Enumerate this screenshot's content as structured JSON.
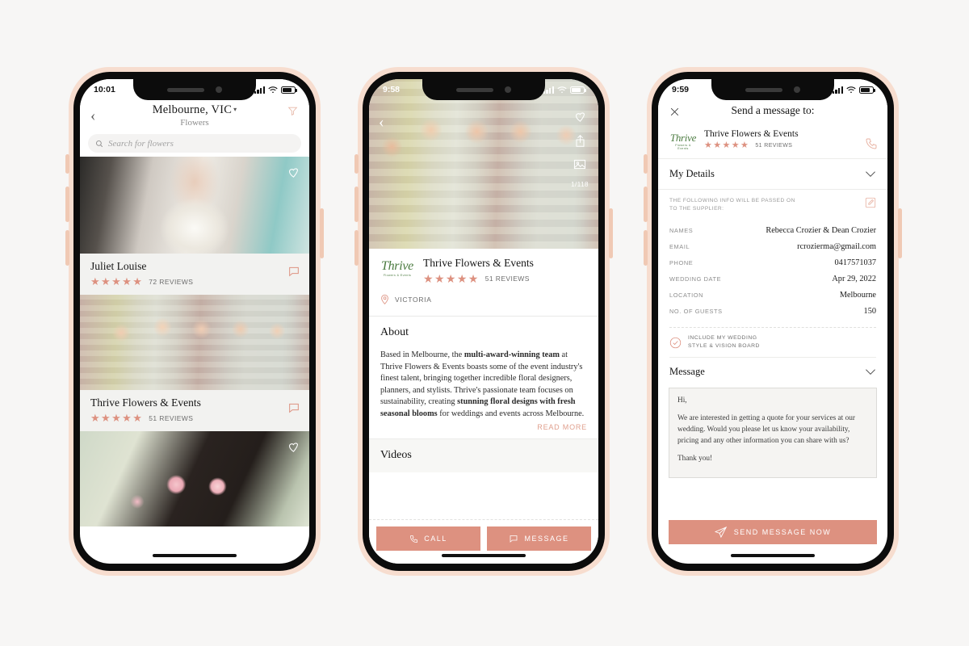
{
  "theme": {
    "accent": "#dd9180",
    "page_background": "#f7f6f5",
    "phone_shell": "#f7ddcf",
    "logo_green": "#4a7a3f"
  },
  "phone1": {
    "status": {
      "time": "10:01"
    },
    "header": {
      "back_icon": "chevron-left-icon",
      "title": "Melbourne, VIC",
      "caret": "▾",
      "subtitle": "Flowers",
      "filter_icon": "filter-funnel-icon"
    },
    "search": {
      "placeholder": "Search for flowers",
      "icon": "search-icon"
    },
    "listings": [
      {
        "name": "Juliet Louise",
        "stars": "★★★★★",
        "reviews": "72 REVIEWS",
        "chat_icon": "chat-bubble-icon",
        "heart_icon": "heart-outline-icon"
      },
      {
        "name": "Thrive Flowers & Events",
        "stars": "★★★★★",
        "reviews": "51 REVIEWS",
        "chat_icon": "chat-bubble-icon",
        "heart_icon": "heart-outline-icon"
      }
    ]
  },
  "phone2": {
    "status": {
      "time": "9:58"
    },
    "hero": {
      "back_icon": "chevron-left-icon",
      "heart_icon": "heart-outline-icon",
      "share_icon": "share-icon",
      "gallery_icon": "gallery-icon",
      "photo_count": "1/118"
    },
    "business": {
      "logo_word": "Thrive",
      "logo_tagline": "Flowers & Events",
      "name": "Thrive Flowers & Events",
      "stars": "★★★★★",
      "reviews": "51 REVIEWS",
      "location_icon": "location-pin-icon",
      "location": "VICTORIA"
    },
    "about": {
      "title": "About",
      "paragraph_parts": [
        {
          "text": "Based in Melbourne, the ",
          "bold": false
        },
        {
          "text": "multi-award-winning team",
          "bold": true
        },
        {
          "text": " at Thrive Flowers & Events boasts some of the event industry's finest talent, bringing together incredible floral designers, planners, and stylists. Thrive's passionate team focuses on sustainability, creating ",
          "bold": false
        },
        {
          "text": "stunning floral designs with fresh seasonal blooms",
          "bold": true
        },
        {
          "text": " for weddings and events across Melbourne. Their gorgeous floral arrangements include bouquets,",
          "bold": false
        }
      ],
      "read_more": "READ MORE"
    },
    "videos": {
      "title": "Videos"
    },
    "actions": [
      {
        "label": "CALL",
        "icon": "phone-icon"
      },
      {
        "label": "MESSAGE",
        "icon": "chat-bubble-icon"
      }
    ]
  },
  "phone3": {
    "status": {
      "time": "9:59"
    },
    "header": {
      "close_icon": "close-x-icon",
      "title": "Send a message to:"
    },
    "supplier": {
      "logo_word": "Thrive",
      "logo_tagline": "Flowers & Events",
      "name": "Thrive Flowers & Events",
      "stars": "★★★★★",
      "reviews": "51 REVIEWS",
      "call_icon": "phone-icon"
    },
    "my_details": {
      "title": "My Details",
      "chevron_icon": "chevron-down-icon",
      "notice_line1": "THE FOLLOWING INFO WILL BE PASSED ON",
      "notice_line2": "TO THE SUPPLIER:",
      "edit_icon": "edit-pencil-icon",
      "rows": [
        {
          "label": "NAMES",
          "value": "Rebecca Crozier & Dean Crozier"
        },
        {
          "label": "EMAIL",
          "value": "rcrozierma@gmail.com"
        },
        {
          "label": "PHONE",
          "value": "0417571037"
        },
        {
          "label": "WEDDING DATE",
          "value": "Apr 29, 2022"
        },
        {
          "label": "LOCATION",
          "value": "Melbourne"
        },
        {
          "label": "NO. OF GUESTS",
          "value": "150"
        }
      ],
      "vision_board": {
        "check_icon": "check-circle-icon",
        "line1": "INCLUDE MY WEDDING",
        "line2": "STYLE & VISION BOARD"
      }
    },
    "message": {
      "title": "Message",
      "chevron_icon": "chevron-down-icon",
      "paragraphs": [
        "Hi,",
        "We are interested in getting a quote for your services at our wedding. Would you please let us know your availability, pricing and any other information you can share with us?",
        "Thank you!"
      ]
    },
    "send_button": {
      "label": "SEND MESSAGE NOW",
      "icon": "paper-plane-icon"
    }
  }
}
